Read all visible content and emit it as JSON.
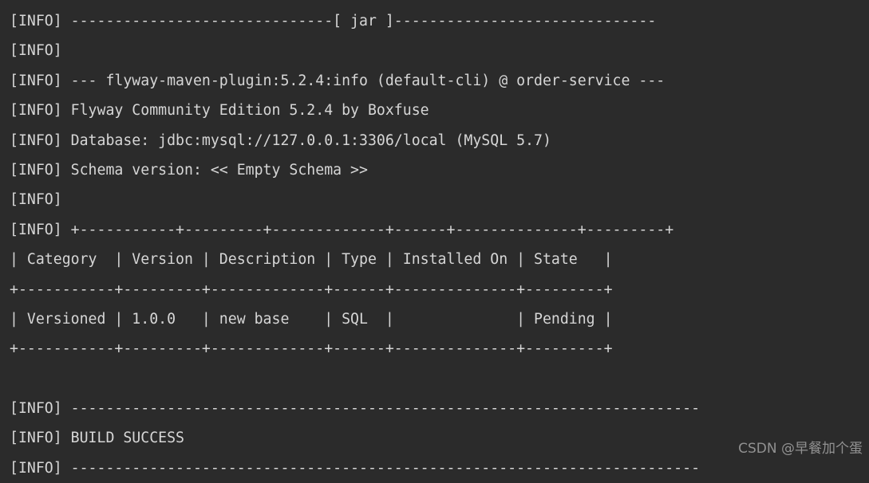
{
  "terminal": {
    "background_color": "#2b2b2b",
    "text_color": "#d6d6d6",
    "lines": [
      {
        "id": "line-jar-separator",
        "text": "[INFO] ------------------------------[ jar ]------------------------------"
      },
      {
        "id": "line-info-blank-1",
        "text": "[INFO]"
      },
      {
        "id": "line-plugin-goal",
        "text": "[INFO] --- flyway-maven-plugin:5.2.4:info (default-cli) @ order-service ---"
      },
      {
        "id": "line-flyway-edition",
        "text": "[INFO] Flyway Community Edition 5.2.4 by Boxfuse"
      },
      {
        "id": "line-database-url",
        "text": "[INFO] Database: jdbc:mysql://127.0.0.1:3306/local (MySQL 5.7)"
      },
      {
        "id": "line-schema-version",
        "text": "[INFO] Schema version: << Empty Schema >>"
      },
      {
        "id": "line-info-blank-2",
        "text": "[INFO]"
      },
      {
        "id": "line-table-top-rule",
        "text": "[INFO] +-----------+---------+-------------+------+--------------+---------+"
      },
      {
        "id": "line-table-header",
        "text": "| Category  | Version | Description | Type | Installed On | State   |"
      },
      {
        "id": "line-table-mid-rule",
        "text": "+-----------+---------+-------------+------+--------------+---------+"
      },
      {
        "id": "line-table-row-1",
        "text": "| Versioned | 1.0.0   | new base    | SQL  |              | Pending |"
      },
      {
        "id": "line-table-bot-rule",
        "text": "+-----------+---------+-------------+------+--------------+---------+"
      },
      {
        "id": "line-empty-1",
        "text": " "
      },
      {
        "id": "line-build-rule-top",
        "text": "[INFO] ------------------------------------------------------------------------"
      },
      {
        "id": "line-build-status",
        "text": "[INFO] BUILD SUCCESS"
      },
      {
        "id": "line-build-rule-bot",
        "text": "[INFO] ------------------------------------------------------------------------"
      }
    ]
  },
  "watermark": {
    "text": "CSDN @早餐加个蛋",
    "color": "#9a9a9a"
  },
  "log_table": {
    "columns": [
      "Category",
      "Version",
      "Description",
      "Type",
      "Installed On",
      "State"
    ],
    "rows": [
      [
        "Versioned",
        "1.0.0",
        "new base",
        "SQL",
        "",
        "Pending"
      ]
    ]
  },
  "build_info": {
    "plugin": "flyway-maven-plugin:5.2.4:info",
    "execution_id": "default-cli",
    "module": "order-service",
    "packaging": "jar",
    "edition": "Flyway Community Edition 5.2.4 by Boxfuse",
    "database": "jdbc:mysql://127.0.0.1:3306/local (MySQL 5.7)",
    "schema_version": "<< Empty Schema >>",
    "result": "BUILD SUCCESS"
  }
}
